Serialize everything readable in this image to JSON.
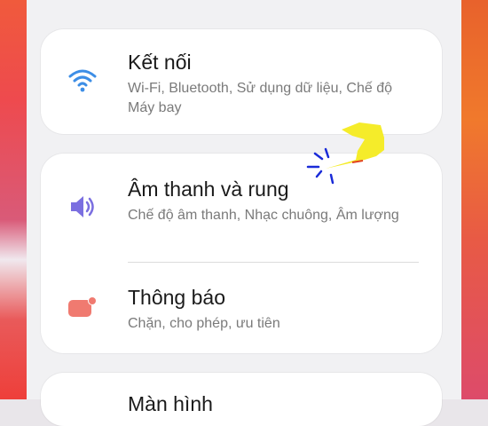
{
  "settings": {
    "connections": {
      "title": "Kết nối",
      "subtitle": "Wi-Fi, Bluetooth, Sử dụng dữ liệu, Chế độ Máy bay",
      "icon": "wifi-icon"
    },
    "sound": {
      "title": "Âm thanh và rung",
      "subtitle": "Chế độ âm thanh, Nhạc chuông, Âm lượng",
      "icon": "speaker-icon"
    },
    "notifications": {
      "title": "Thông báo",
      "subtitle": "Chặn, cho phép, ưu tiên",
      "icon": "notification-badge-icon"
    },
    "display": {
      "title": "Màn hình"
    }
  },
  "colors": {
    "wifi": "#3d8ee6",
    "sound": "#7b6fe0",
    "notification": "#f07a70",
    "pointer": "#f5ec2a"
  }
}
